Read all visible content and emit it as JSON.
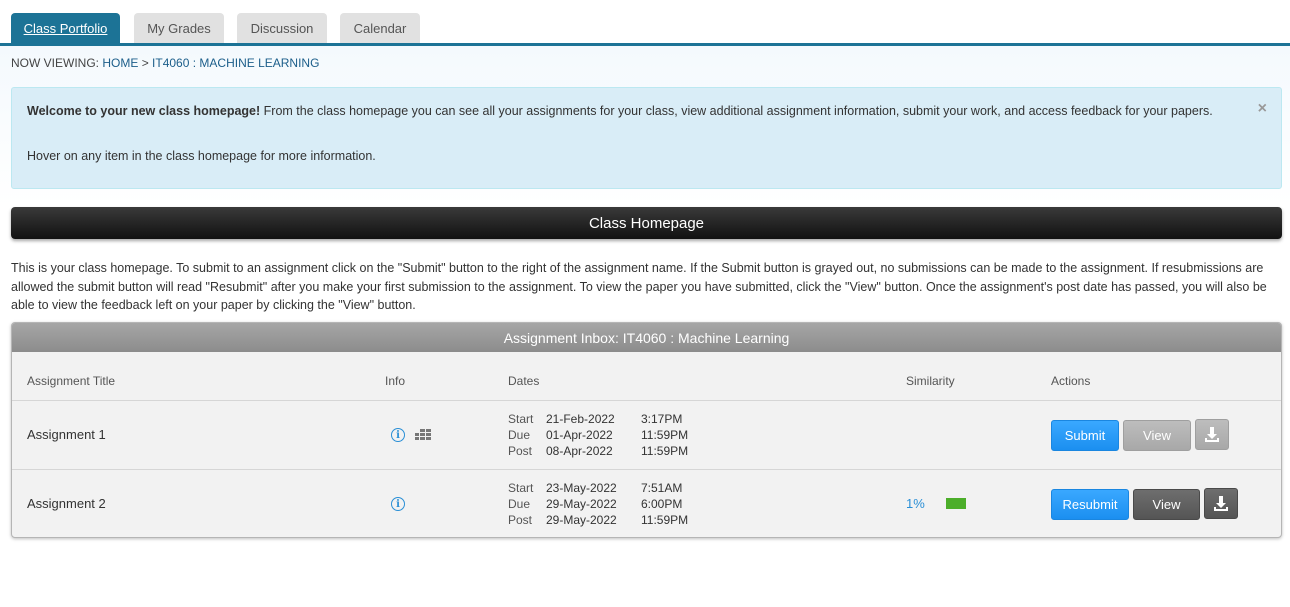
{
  "tabs": [
    {
      "label": "Class Portfolio",
      "active": true
    },
    {
      "label": "My Grades"
    },
    {
      "label": "Discussion"
    },
    {
      "label": "Calendar"
    }
  ],
  "breadcrumb": {
    "prefix": "NOW VIEWING:",
    "home": "HOME",
    "separator": ">",
    "current": "IT4060 : MACHINE LEARNING"
  },
  "welcome": {
    "bold": "Welcome to your new class homepage!",
    "text": " From the class homepage you can see all your assignments for your class, view additional assignment information, submit your work, and access feedback for your papers.",
    "hover": "Hover on any item in the class homepage for more information.",
    "close": "×"
  },
  "homepage_title": "Class Homepage",
  "intro": "This is your class homepage. To submit to an assignment click on the \"Submit\" button to the right of the assignment name. If the Submit button is grayed out, no submissions can be made to the assignment. If resubmissions are allowed the submit button will read \"Resubmit\" after you make your first submission to the assignment. To view the paper you have submitted, click the \"View\" button. Once the assignment's post date has passed, you will also be able to view the feedback left on your paper by clicking the \"View\" button.",
  "inbox": {
    "title": "Assignment Inbox: IT4060 : Machine Learning",
    "columns": {
      "title": "Assignment Title",
      "info": "Info",
      "dates": "Dates",
      "similarity": "Similarity",
      "actions": "Actions"
    },
    "rows": [
      {
        "title": "Assignment 1",
        "start_label": "Start",
        "start_date": "21-Feb-2022",
        "start_time": "3:17PM",
        "due_label": "Due",
        "due_date": "01-Apr-2022",
        "due_time": "11:59PM",
        "post_label": "Post",
        "post_date": "08-Apr-2022",
        "post_time": "11:59PM",
        "similarity": "",
        "submit_label": "Submit",
        "view_label": "View"
      },
      {
        "title": "Assignment 2",
        "start_label": "Start",
        "start_date": "23-May-2022",
        "start_time": "7:51AM",
        "due_label": "Due",
        "due_date": "29-May-2022",
        "due_time": "6:00PM",
        "post_label": "Post",
        "post_date": "29-May-2022",
        "post_time": "11:59PM",
        "similarity": "1%",
        "similarity_color": "#4cae2a",
        "submit_label": "Resubmit",
        "view_label": "View"
      }
    ]
  },
  "colors": {
    "accent": "#1c7396",
    "button_blue": "#1b8ff0",
    "alert_bg": "#d9edf7"
  },
  "icons": [
    "info-icon",
    "grid-icon",
    "download-icon",
    "close-icon"
  ]
}
